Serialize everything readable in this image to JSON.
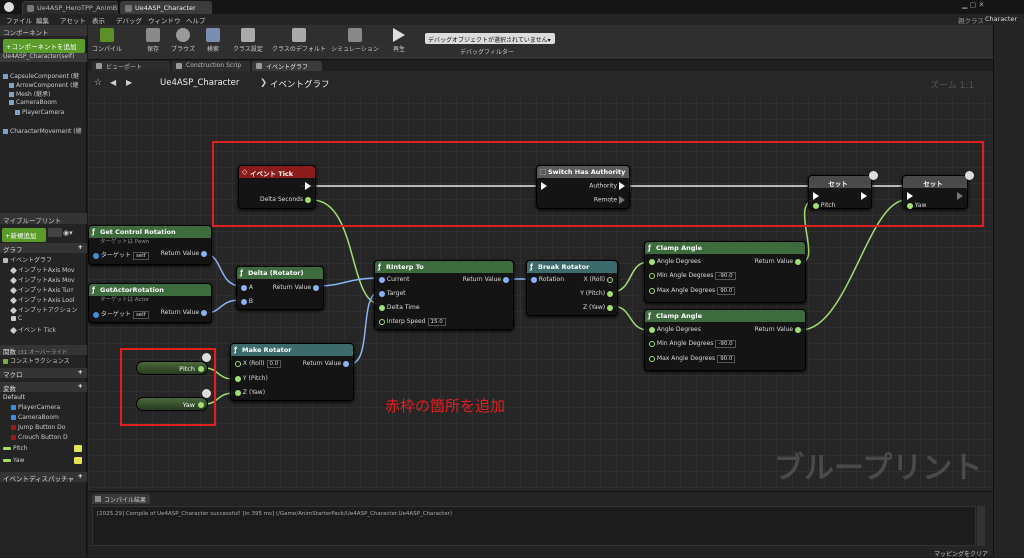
{
  "window": {
    "tabs": [
      "Ue4ASP_HeroTPP_AnimB",
      "Ue4ASP_Character"
    ],
    "parent_class_label": "親クラス",
    "parent_class_value": "Character"
  },
  "menu": [
    "ファイル",
    "編集",
    "アセット",
    "表示",
    "デバッグ",
    "ウィンドウ",
    "ヘルプ"
  ],
  "components": {
    "header": "コンポーネント",
    "add_button": "+コンポーネントを追加",
    "self": "Ue4ASP_Character(self)",
    "items": [
      "CapsuleComponent (継",
      "ArrowComponent (継",
      "Mesh (継承)",
      "CameraBoom",
      "PlayerCamera",
      "CharacterMovement (継"
    ]
  },
  "mybp": {
    "header": "マイブループリント",
    "new_button": "+新規追加",
    "graph_header": "グラフ",
    "event_graph": "イベントグラフ",
    "graph_items": [
      "インプットAxis Mov",
      "インプットAxis Mov",
      "インプットAxis Turr",
      "インプットAxis Lool",
      "インプットアクション",
      "C",
      "イベント Tick"
    ],
    "functions_header": "関数",
    "functions_override": "(31 オーバーライド",
    "construction": "コンストラクションス",
    "macros_header": "マクロ",
    "variables_header": "変数",
    "default": "Default",
    "variables": [
      "PlayerCamera",
      "CameraBoom",
      "Jump Button Do",
      "Crouch Button D",
      "Pitch",
      "Yaw"
    ],
    "dispatchers": "イベントディスパッチャ"
  },
  "toolbar": {
    "buttons": [
      "コンパイル",
      "保存",
      "ブラウズ",
      "検索",
      "クラス設定",
      "クラスのデフォルト",
      "シミュレーション",
      "再生"
    ],
    "debug_select": "デバッグオブジェクトが選択されていません▾",
    "debug_filter": "デバッグフィルター"
  },
  "editor_tabs": [
    "ビューポート",
    "Construction Scrip",
    "イベントグラフ"
  ],
  "graph": {
    "breadcrumb_bp": "Ue4ASP_Character",
    "breadcrumb_graph": "イベントグラフ",
    "zoom": "ズーム 1:1",
    "watermark": "ブループリント",
    "annotation": "赤枠の箇所を追加"
  },
  "nodes": {
    "event_tick": {
      "title": "イベント Tick",
      "delta": "Delta Seconds"
    },
    "switch_auth": {
      "title": "Switch Has Authority",
      "authority": "Authority",
      "remote": "Remote"
    },
    "set1": {
      "title": "セット",
      "pin": "Pitch"
    },
    "set2": {
      "title": "セット",
      "pin": "Yaw"
    },
    "get_ctrl": {
      "title": "Get Control Rotation",
      "sub": "ターゲットは Pawn",
      "target": "ターゲット",
      "self": "self",
      "ret": "Return Value"
    },
    "get_actor": {
      "title": "GetActorRotation",
      "sub": "ターゲットは Actor",
      "target": "ターゲット",
      "self": "self",
      "ret": "Return Value"
    },
    "delta_rot": {
      "title": "Delta (Rotator)",
      "a": "A",
      "b": "B",
      "ret": "Return Value"
    },
    "rinterp": {
      "title": "RInterp To",
      "current": "Current",
      "target": "Target",
      "delta": "Delta Time",
      "speed": "Interp Speed",
      "speed_val": "15.0",
      "ret": "Return Value"
    },
    "break_rot": {
      "title": "Break Rotator",
      "rot": "Rotation",
      "x": "X (Roll)",
      "y": "Y (Pitch)",
      "z": "Z (Yaw)"
    },
    "clamp1": {
      "title": "Clamp Angle",
      "deg": "Angle Degrees",
      "min": "Min Angle Degrees",
      "min_val": "-90.0",
      "max": "Max Angle Degrees",
      "max_val": "90.0",
      "ret": "Return Value"
    },
    "clamp2": {
      "title": "Clamp Angle",
      "deg": "Angle Degrees",
      "min": "Min Angle Degrees",
      "min_val": "-90.0",
      "max": "Max Angle Degrees",
      "max_val": "90.0",
      "ret": "Return Value"
    },
    "make_rot": {
      "title": "Make Rotator",
      "x": "X (Roll)",
      "x_val": "0.0",
      "y": "Y (Pitch)",
      "z": "Z (Yaw)",
      "ret": "Return Value"
    },
    "var_pitch": "Pitch",
    "var_yaw": "Yaw"
  },
  "compile": {
    "tab": "コンパイル結果",
    "message": "[2025.29] Compile of Ue4ASP_Character successful! [in 395 ms] (/Game/AnimStarterPack/Ue4ASP_Character.Ue4ASP_Character)",
    "clear": "マッピングをクリア"
  },
  "colors": {
    "event_red": "#8b1a1a",
    "function_green": "#3d6b3d",
    "exec_gray": "#5a5a5a",
    "variable_green": "#a5e05a",
    "struct_blue": "#8ab4f8",
    "float_green": "#a0e070",
    "annotation": "#e02020"
  }
}
